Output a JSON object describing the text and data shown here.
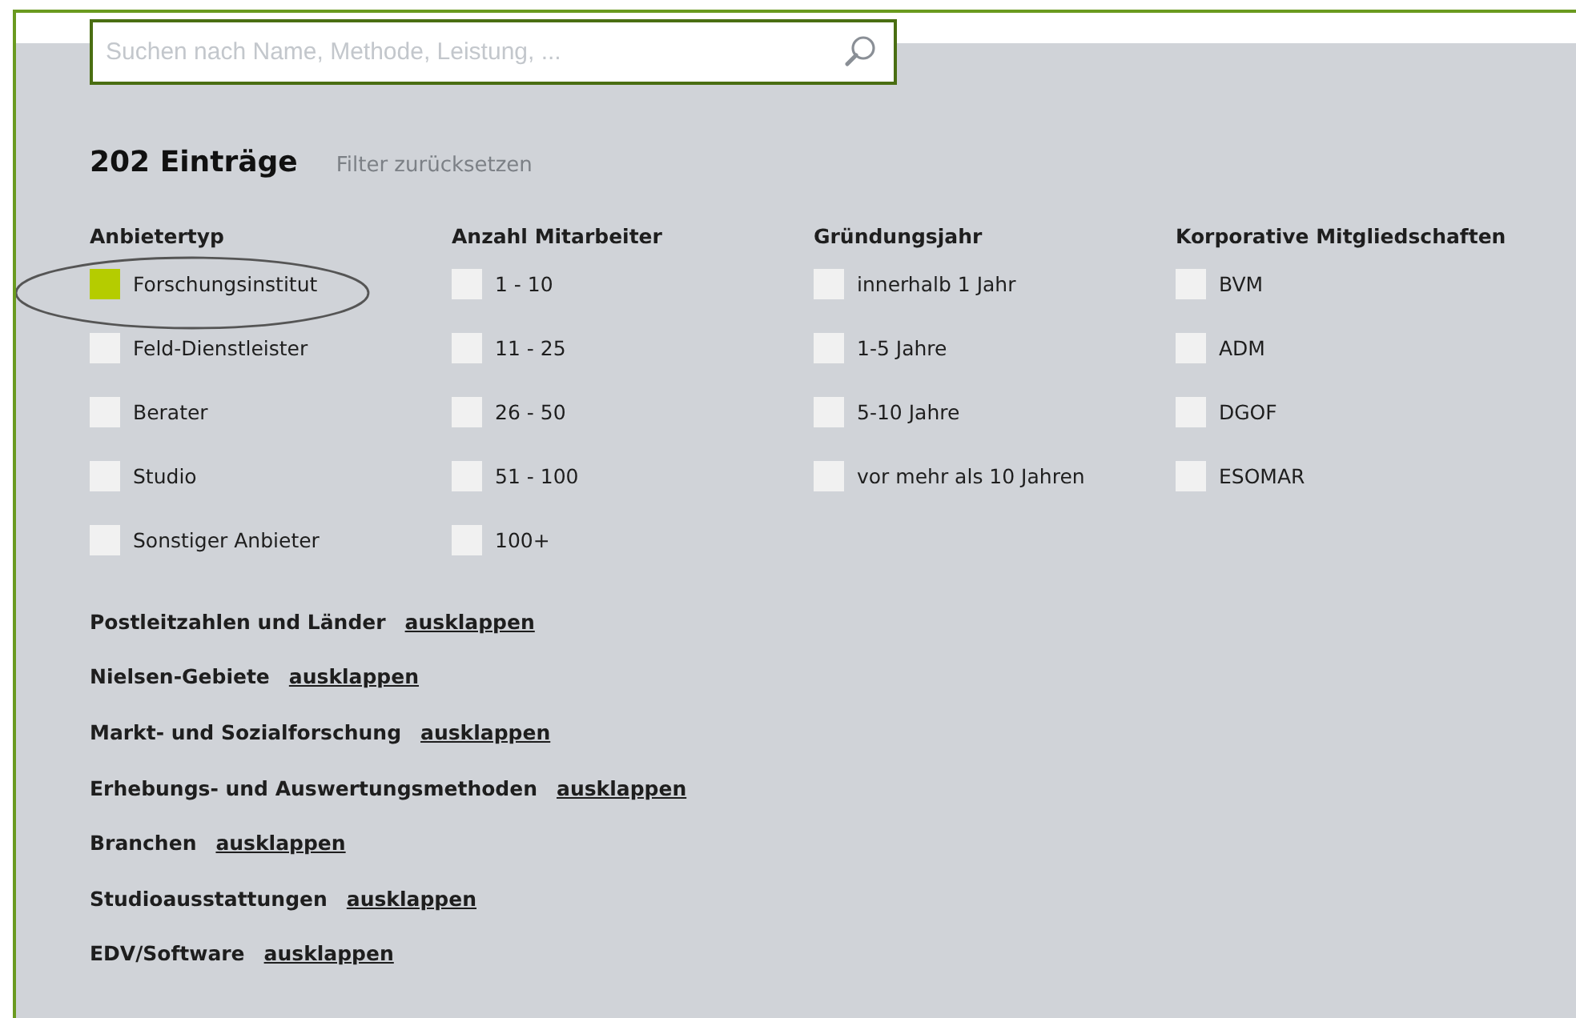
{
  "search": {
    "placeholder": "Suchen nach Name, Methode, Leistung, ..."
  },
  "result_count": "202 Einträge",
  "reset_link": "Filter zurücksetzen",
  "filter_groups": [
    {
      "title": "Anbietertyp",
      "options": [
        {
          "label": "Forschungsinstitut",
          "checked": true,
          "highlighted": true
        },
        {
          "label": "Feld-Dienstleister",
          "checked": false
        },
        {
          "label": "Berater",
          "checked": false
        },
        {
          "label": "Studio",
          "checked": false
        },
        {
          "label": "Sonstiger Anbieter",
          "checked": false
        }
      ]
    },
    {
      "title": "Anzahl Mitarbeiter",
      "options": [
        {
          "label": "1 - 10",
          "checked": false
        },
        {
          "label": "11 - 25",
          "checked": false
        },
        {
          "label": "26 - 50",
          "checked": false
        },
        {
          "label": "51 - 100",
          "checked": false
        },
        {
          "label": "100+",
          "checked": false
        }
      ]
    },
    {
      "title": "Gründungsjahr",
      "options": [
        {
          "label": "innerhalb 1 Jahr",
          "checked": false
        },
        {
          "label": "1-5 Jahre",
          "checked": false
        },
        {
          "label": "5-10 Jahre",
          "checked": false
        },
        {
          "label": "vor mehr als 10 Jahren",
          "checked": false
        }
      ]
    },
    {
      "title": "Korporative Mitgliedschaften",
      "options": [
        {
          "label": "BVM",
          "checked": false
        },
        {
          "label": "ADM",
          "checked": false
        },
        {
          "label": "DGOF",
          "checked": false
        },
        {
          "label": "ESOMAR",
          "checked": false
        }
      ]
    }
  ],
  "sections": [
    {
      "title": "Postleitzahlen und Länder",
      "link": "ausklappen"
    },
    {
      "title": "Nielsen-Gebiete",
      "link": "ausklappen"
    },
    {
      "title": "Markt- und Sozialforschung",
      "link": "ausklappen"
    },
    {
      "title": "Erhebungs- und Auswertungsmethoden",
      "link": "ausklappen"
    },
    {
      "title": "Branchen",
      "link": "ausklappen"
    },
    {
      "title": "Studioausstattungen",
      "link": "ausklappen"
    },
    {
      "title": "EDV/Software",
      "link": "ausklappen"
    }
  ]
}
